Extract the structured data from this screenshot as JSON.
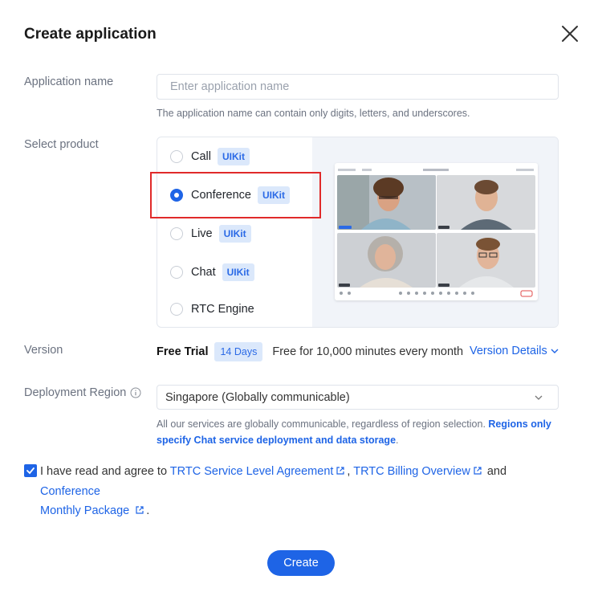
{
  "dialog": {
    "title": "Create application"
  },
  "app_name": {
    "label": "Application name",
    "placeholder": "Enter application name",
    "value": "",
    "hint": "The application name can contain only digits, letters, and underscores."
  },
  "product": {
    "label": "Select product",
    "selected": "Conference",
    "options": [
      {
        "name": "Call",
        "badge": "UIKit",
        "selected": false
      },
      {
        "name": "Conference",
        "badge": "UIKit",
        "selected": true
      },
      {
        "name": "Live",
        "badge": "UIKit",
        "selected": false
      },
      {
        "name": "Chat",
        "badge": "UIKit",
        "selected": false
      },
      {
        "name": "RTC Engine",
        "badge": "",
        "selected": false
      }
    ]
  },
  "version": {
    "label": "Version",
    "plan": "Free Trial",
    "days_badge": "14 Days",
    "description": "Free for 10,000 minutes every month",
    "details_link": "Version Details"
  },
  "region": {
    "label": "Deployment Region",
    "selected": "Singapore (Globally communicable)",
    "hint_prefix": "All our services are globally communicable, regardless of region selection.",
    "hint_bold_line1": "Regions only",
    "hint_bold_line2": "specify Chat service deployment and data storage",
    "hint_suffix": "."
  },
  "agreement": {
    "checked": true,
    "text_prefix": "I have read and agree to",
    "link_sla": "TRTC Service Level Agreement",
    "comma": ",",
    "link_billing": "TRTC Billing Overview",
    "and": "and",
    "link_conference_line1": "Conference",
    "link_conference_line2": "Monthly Package",
    "period": "."
  },
  "footer": {
    "create_label": "Create"
  },
  "colors": {
    "accent": "#1e64e6",
    "badge_bg": "#dbe8fb",
    "highlight": "#e02a2a"
  }
}
